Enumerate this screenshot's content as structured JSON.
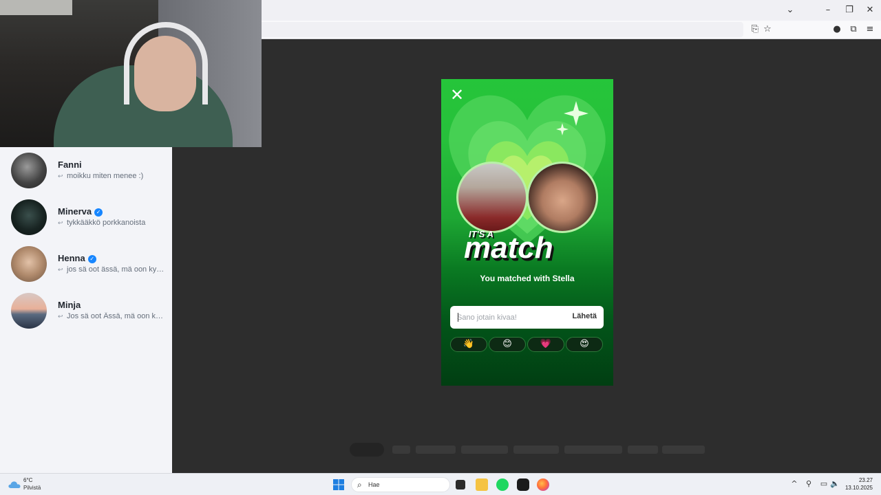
{
  "browser": {
    "toolbar_icons": [
      "save-page-icon",
      "bookmark-star-icon",
      "profile-icon",
      "extensions-icon",
      "menu-icon"
    ]
  },
  "chats": [
    {
      "name": "Fanni",
      "verified": false,
      "preview": "moikku miten menee :)"
    },
    {
      "name": "Minerva",
      "verified": true,
      "preview": "tykkääkkö porkkanoista"
    },
    {
      "name": "Henna",
      "verified": true,
      "preview": "jos sä oot ässä, mä oon kyykky"
    },
    {
      "name": "Minja",
      "verified": false,
      "preview": "Jos sä oot Ässä, mä oon kyykky"
    }
  ],
  "match": {
    "logo_top": "IT'S A",
    "logo_main": "match",
    "subtitle": "You matched with Stella",
    "input_placeholder": "Sano jotain kivaa!",
    "send_label": "Lähetä",
    "emojis": [
      "👋",
      "😊",
      "💗",
      "😍"
    ],
    "accent": "#25c53a"
  },
  "taskbar": {
    "weather_temp": "6°C",
    "weather_desc": "Pilvistä",
    "search_label": "Hae",
    "time": "23.27",
    "date": "13.10.2025"
  }
}
